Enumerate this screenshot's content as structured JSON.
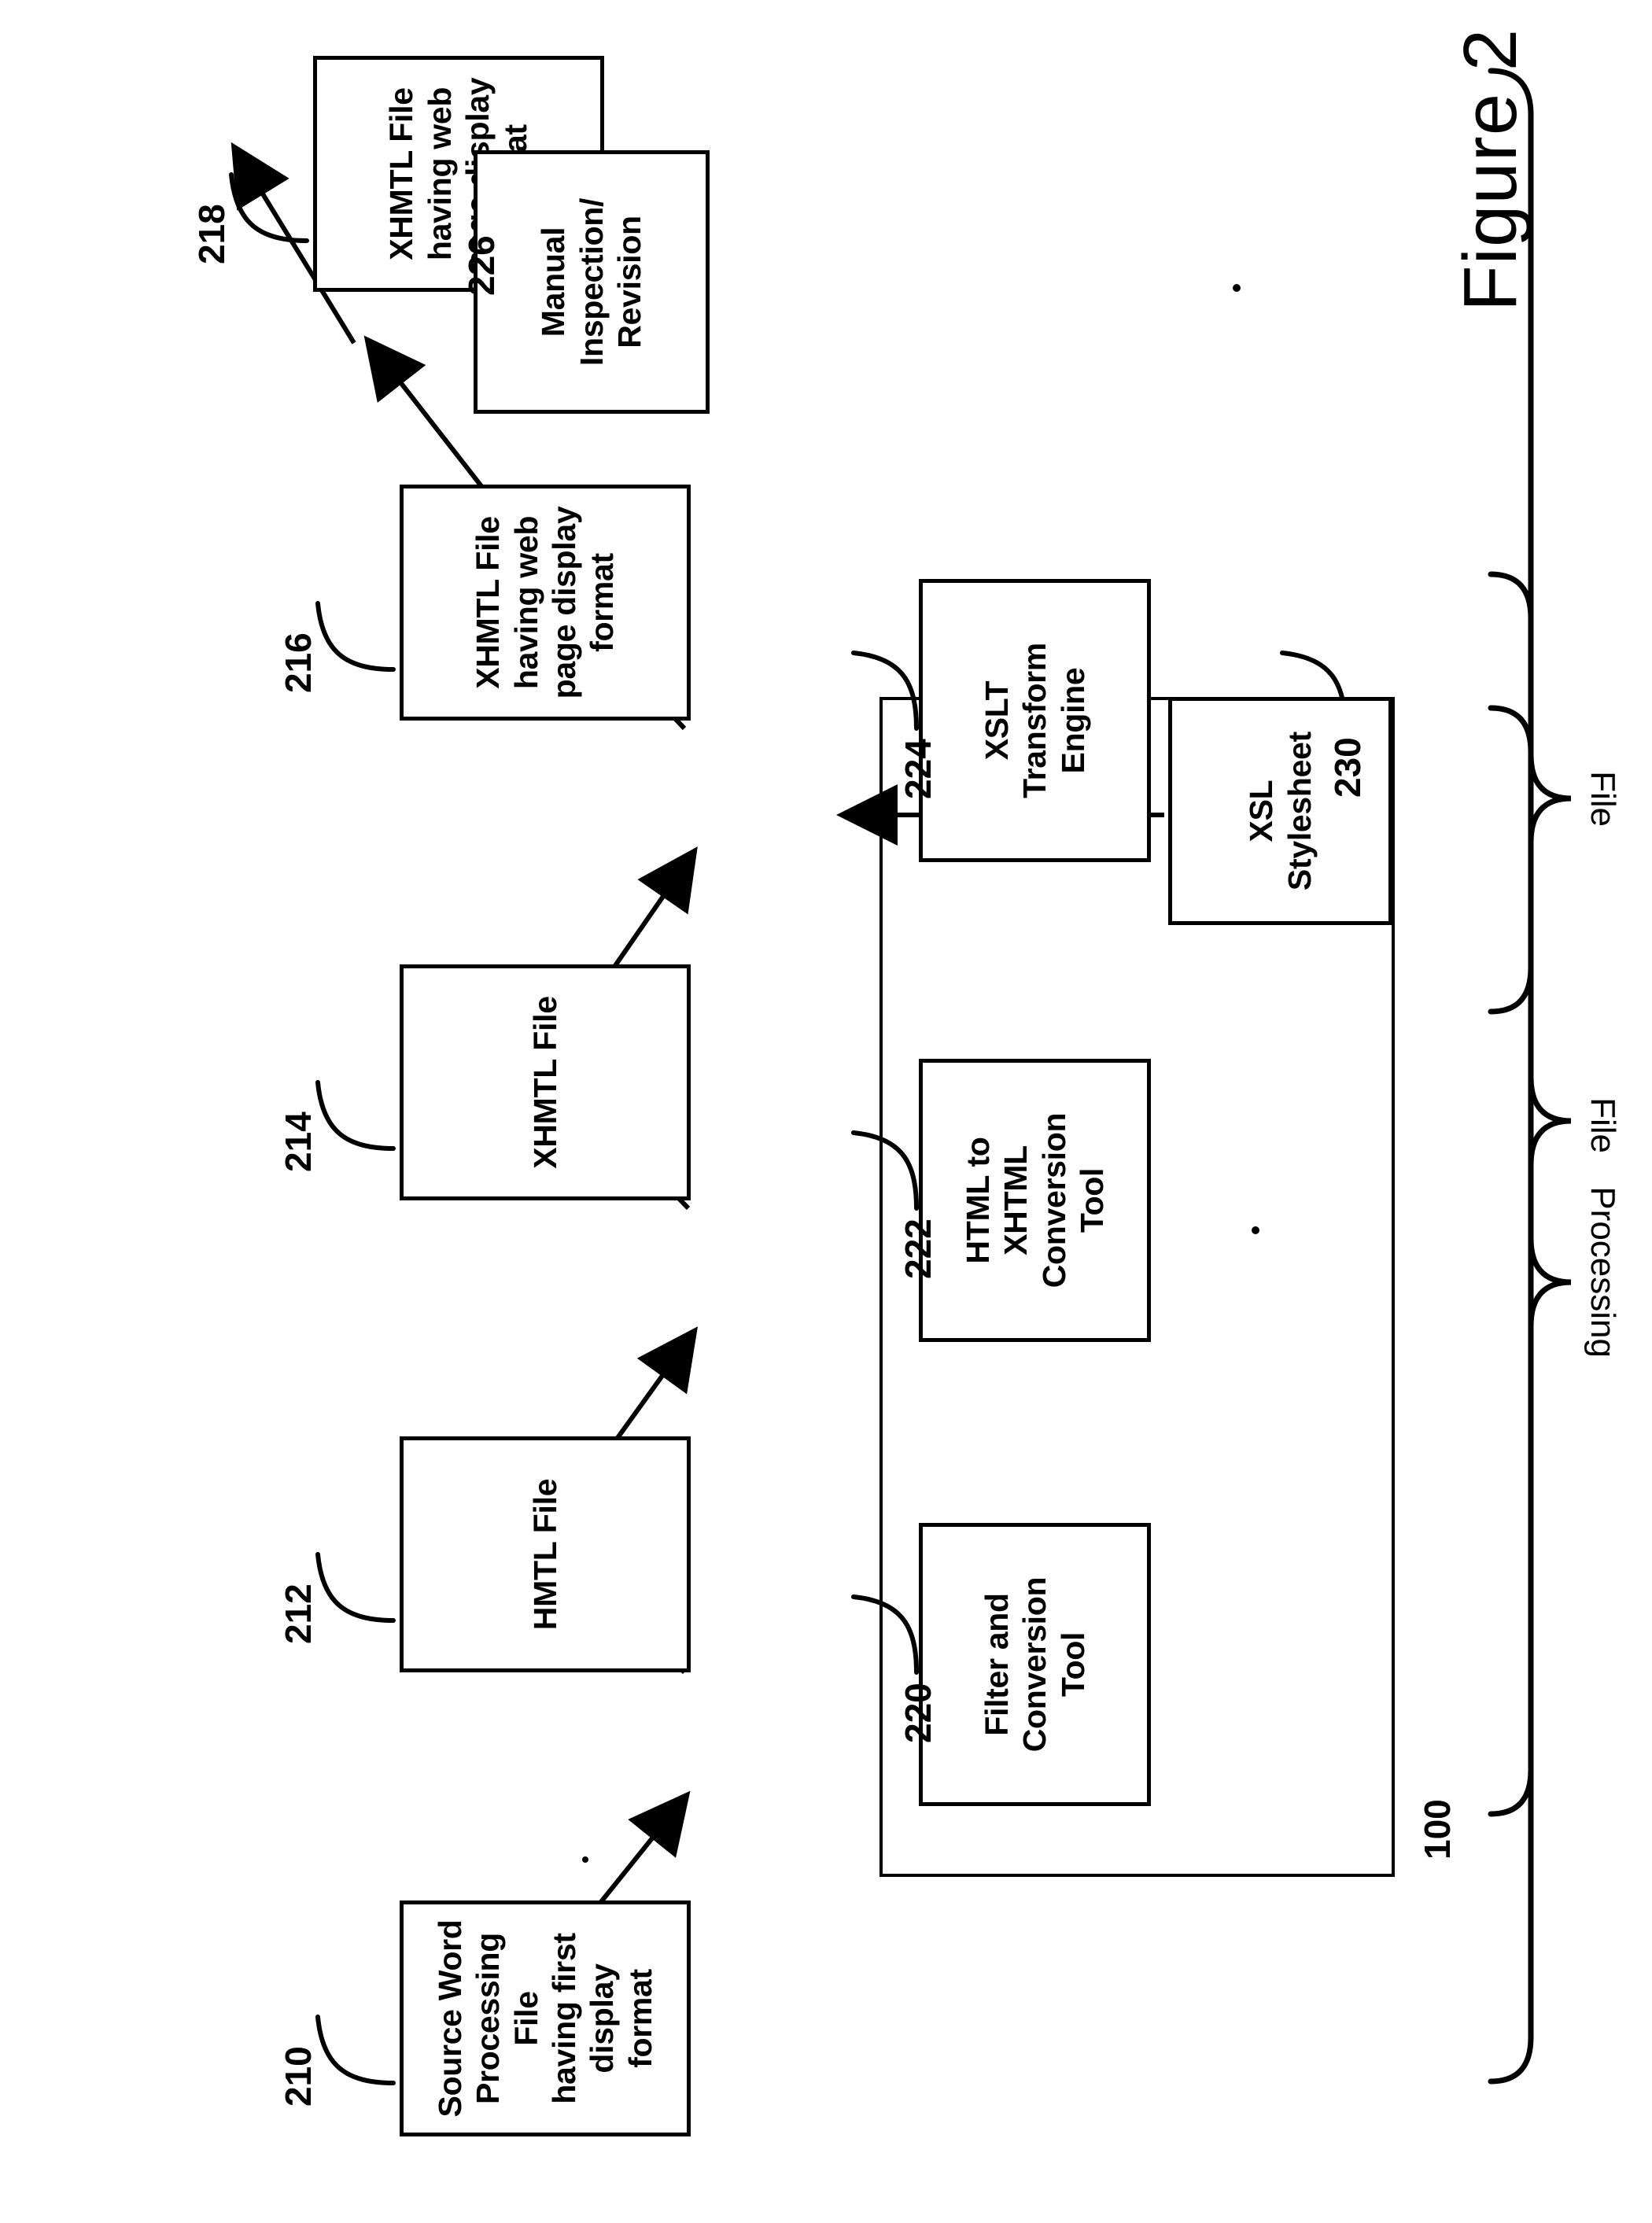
{
  "figure": {
    "caption": "Figure 2",
    "system_ref": "100"
  },
  "file_boxes_top": [
    {
      "ref": "210",
      "label": "Source Word\nProcessing File\nhaving first\ndisplay format",
      "name": "source-word-processing-file-box"
    },
    {
      "ref": "212",
      "label": "HMTL File",
      "name": "hmtl-file-box"
    },
    {
      "ref": "214",
      "label": "XHMTL File",
      "name": "xhmtl-file-box"
    },
    {
      "ref": "216",
      "label": "XHMTL File\nhaving web\npage display\nformat",
      "name": "xhmtl-web-page-file-box-216"
    },
    {
      "ref": "218",
      "label": "XHMTL File\nhaving web\npage display\nformat",
      "name": "xhmtl-web-page-file-box-218"
    }
  ],
  "processing_boxes": [
    {
      "ref": "220",
      "label": "Filter and\nConversion\nTool",
      "name": "filter-and-conversion-tool-box"
    },
    {
      "ref": "222",
      "label": "HTML to\nXHTML\nConversion\nTool",
      "name": "html-to-xhtml-conversion-tool-box"
    },
    {
      "ref": "224",
      "label": "XSLT\nTransform\nEngine",
      "name": "xslt-transform-engine-box"
    }
  ],
  "manual_box": {
    "ref": "226",
    "label": "Manual\nInspection/\nRevision",
    "name": "manual-inspection-revision-box"
  },
  "stylesheet_box": {
    "ref": "230",
    "label": "XSL\nStylesheet",
    "name": "xsl-stylesheet-box"
  },
  "brace_labels": [
    {
      "text": "File",
      "name": "brace-label-file-left"
    },
    {
      "text": "Processing",
      "name": "brace-label-processing"
    },
    {
      "text": "File",
      "name": "brace-label-file-right"
    }
  ]
}
